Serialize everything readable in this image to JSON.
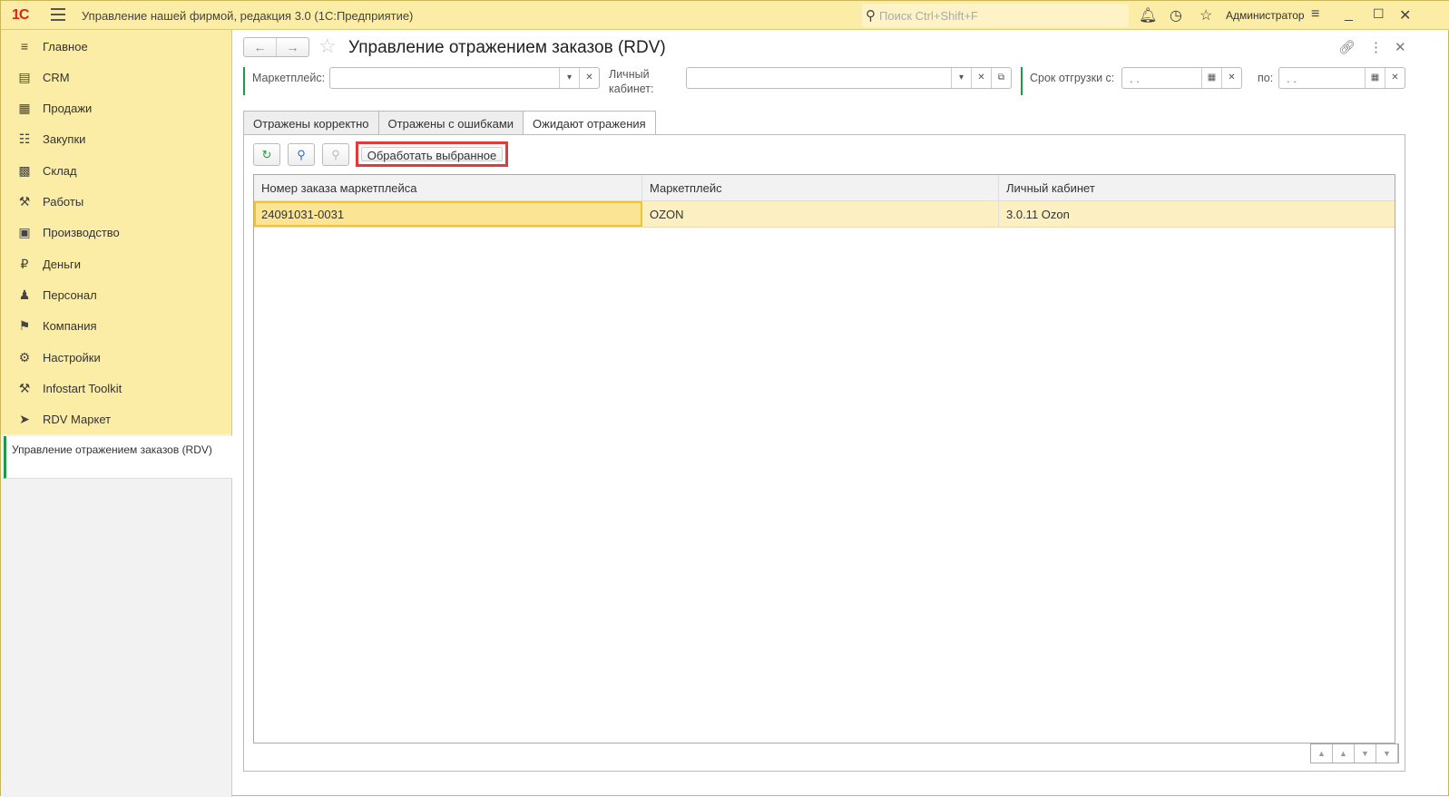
{
  "app": {
    "title": "Управление нашей фирмой, редакция 3.0  (1С:Предприятие)",
    "logo": "1С",
    "search_placeholder": "Поиск Ctrl+Shift+F",
    "user": "Администратор"
  },
  "sidebar": {
    "items": [
      {
        "label": "Главное",
        "icon": "menu-icon"
      },
      {
        "label": "CRM",
        "icon": "contact-card-icon"
      },
      {
        "label": "Продажи",
        "icon": "basket-icon"
      },
      {
        "label": "Закупки",
        "icon": "cart-icon"
      },
      {
        "label": "Склад",
        "icon": "warehouse-icon"
      },
      {
        "label": "Работы",
        "icon": "tools-icon"
      },
      {
        "label": "Производство",
        "icon": "factory-icon"
      },
      {
        "label": "Деньги",
        "icon": "ruble-icon"
      },
      {
        "label": "Персонал",
        "icon": "people-icon"
      },
      {
        "label": "Компания",
        "icon": "flag-icon"
      },
      {
        "label": "Настройки",
        "icon": "gear-icon"
      },
      {
        "label": "Infostart Toolkit",
        "icon": "wrench-icon"
      },
      {
        "label": "RDV Маркет",
        "icon": "rocket-icon"
      }
    ],
    "open_window": "Управление отражением заказов (RDV)"
  },
  "form": {
    "title": "Управление отражением заказов (RDV)",
    "filters": {
      "marketplace_label": "Маркетплейс:",
      "marketplace_value": "",
      "cabinet_label_1": "Личный",
      "cabinet_label_2": "кабинет:",
      "cabinet_value": "",
      "ship_from_label": "Срок отгрузки с:",
      "ship_from_value": " .  .",
      "ship_to_label": "по:",
      "ship_to_value": " .  ."
    },
    "tabs": [
      "Отражены корректно",
      "Отражены с ошибками",
      "Ожидают отражения"
    ],
    "active_tab": 2,
    "toolbar": {
      "process_label": "Обработать выбранное"
    },
    "table": {
      "columns": [
        "Номер заказа маркетплейса",
        "Маркетплейс",
        "Личный кабинет"
      ],
      "rows": [
        [
          "24091031-0031",
          "OZON",
          "3.0.11 Ozon"
        ]
      ]
    }
  },
  "colors": {
    "accent_green": "#1e9a46",
    "highlight_red": "#e53838",
    "topbar": "#fbeca6"
  }
}
